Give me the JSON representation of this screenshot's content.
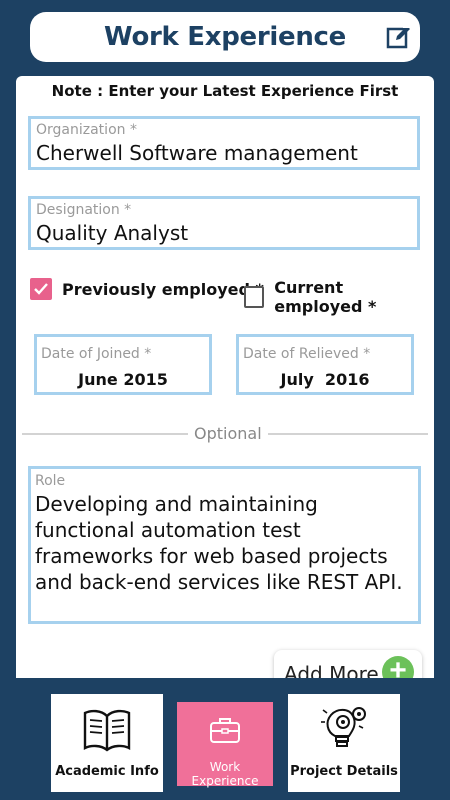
{
  "header": {
    "title": "Work Experience",
    "edit_icon": "edit-icon"
  },
  "form": {
    "note": "Note : Enter your Latest Experience First",
    "organization": {
      "label": "Organization *",
      "value": "Cherwell Software management"
    },
    "designation": {
      "label": "Designation *",
      "value": "Quality Analyst"
    },
    "employment": {
      "previous": {
        "label": "Previously employed *",
        "checked": true
      },
      "current": {
        "label": "Current employed *",
        "checked": false
      }
    },
    "date_joined": {
      "label": "Date of Joined *",
      "value": "June 2015"
    },
    "date_relieved": {
      "label": "Date of Relieved *",
      "value": "July  2016"
    },
    "optional_divider": "Optional",
    "role": {
      "label": "Role",
      "value": "Developing and maintaining functional automation test frameworks for web based projects and back-end services like REST API."
    },
    "add_more": {
      "label": "Add More",
      "icon": "plus-icon"
    }
  },
  "colors": {
    "primary": "#1d4163",
    "accent": "#e8618c",
    "field_border": "#a6d1ee",
    "add_green": "#6cc15a"
  },
  "bottom_nav": {
    "tabs": [
      {
        "label": "Academic Info",
        "icon": "book-icon",
        "active": false
      },
      {
        "label": "Work Experience",
        "icon": "briefcase-icon",
        "active": true
      },
      {
        "label": "Project Details",
        "icon": "lightbulb-gears-icon",
        "active": false
      }
    ]
  }
}
